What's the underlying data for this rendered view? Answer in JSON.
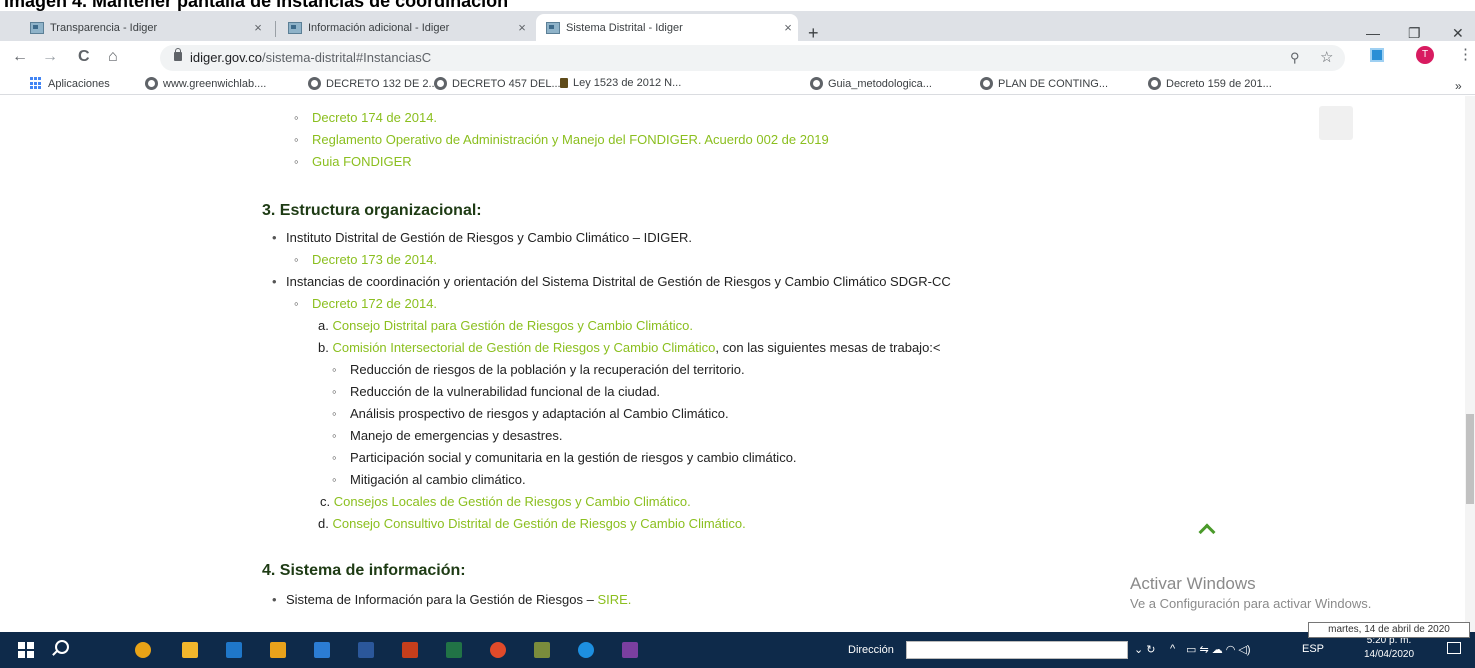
{
  "document_heading": "Imagen 4. Mantener pantalla de instancias de coordinación",
  "browser": {
    "tabs": [
      {
        "label": "Transparencia - Idiger",
        "close": "×"
      },
      {
        "label": "Información adicional - Idiger",
        "close": "×"
      },
      {
        "label": "Sistema Distrital - Idiger",
        "close": "×"
      }
    ],
    "new_tab": "+",
    "window_controls": {
      "minimize": "—",
      "restore": "❐",
      "close": "✕"
    },
    "nav": {
      "back": "←",
      "forward": "→",
      "reload": "C",
      "home": "⌂"
    },
    "url_domain": "idiger.gov.co",
    "url_path": "/sistema-distrital#InstanciasC",
    "zoom_icon": "⚲",
    "star_icon": "☆",
    "profile_initial": "T",
    "menu_icon": "⋮",
    "bookmarks": [
      "Aplicaciones",
      "www.greenwichlab....",
      "DECRETO 132 DE 2...",
      "DECRETO 457 DEL...",
      "Ley 1523 de 2012 N...",
      "Guia_metodologica...",
      "PLAN DE CONTING...",
      "Decreto 159 de 201..."
    ],
    "bookmarks_more": "»"
  },
  "page": {
    "top_links": [
      "Decreto 174 de 2014.",
      "Reglamento Operativo de Administración y Manejo del FONDIGER. Acuerdo 002 de 2019",
      "Guia FONDIGER"
    ],
    "section3": {
      "title": "3. Estructura organizacional:",
      "item1_text": "Instituto Distrital de Gestión de Riesgos y Cambio Climático – IDIGER.",
      "item1_link": "Decreto 173 de 2014.",
      "item2_text": "Instancias de coordinación y orientación del Sistema Distrital de Gestión de Riesgos y Cambio Climático SDGR-CC",
      "item2_link": "Decreto 172 de 2014.",
      "sub_a_marker": "a.",
      "sub_a_link": "Consejo Distrital para Gestión de Riesgos y Cambio Climático.",
      "sub_b_marker": "b.",
      "sub_b_link": "Comisión Intersectorial de Gestión de Riesgos y Cambio Climático",
      "sub_b_suffix": ", con las siguientes mesas de trabajo:<",
      "mesas": [
        "Reducción de riesgos de la población y la recuperación del territorio.",
        "Reducción de la vulnerabilidad funcional de la ciudad.",
        "Análisis prospectivo de riesgos y adaptación al Cambio Climático.",
        "Manejo de emergencias y desastres.",
        "Participación social y comunitaria en la gestión de riesgos y cambio climático.",
        "Mitigación al cambio climático."
      ],
      "sub_c_marker": "c.",
      "sub_c_link": "Consejos Locales de Gestión de Riesgos y Cambio Climático.",
      "sub_d_marker": "d.",
      "sub_d_link": "Consejo Consultivo Distrital de Gestión de Riesgos y Cambio Climático."
    },
    "section4": {
      "title": "4. Sistema de información:",
      "item_text": "Sistema de Información para la Gestión de Riesgos – ",
      "item_link": "SIRE."
    },
    "watermark_title": "Activar Windows",
    "watermark_sub": "Ve a Configuración para activar Windows."
  },
  "taskbar": {
    "address_label": "Dirección",
    "language": "ESP",
    "time": "5:20 p. m.",
    "date": "14/04/2020",
    "tooltip": "martes, 14 de abril de 2020",
    "app_colors": [
      "#e8a317",
      "#f3b72c",
      "#1f77c9",
      "#e9a21b",
      "#2b7cd3",
      "#2b579a",
      "#c43e1c",
      "#217346",
      "#e04a2a",
      "#7a8c3c",
      "#1d8fe0",
      "#7b3fa0"
    ]
  }
}
